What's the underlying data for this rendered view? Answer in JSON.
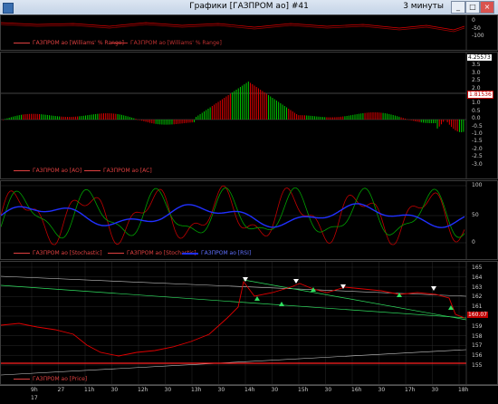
{
  "window": {
    "title": "Графики [ГАЗПРОМ ао] #41",
    "interval": "3 минуты",
    "buttons": [
      "_",
      "□",
      "×"
    ]
  },
  "panes": {
    "wpr": {
      "legend": [
        "ГАЗПРОМ ао [Williams' % Range]",
        "ГАЗПРОМ ао [Williams' % Range]"
      ],
      "ticks": [
        "0",
        "-50",
        "-100"
      ]
    },
    "ao": {
      "legend": [
        "ГАЗПРОМ ао [AO]",
        "ГАЗПРОМ ао [AC]"
      ],
      "ticks": [
        "4.0",
        "3.5",
        "3.0",
        "2.5",
        "2.0",
        "1.5",
        "1.0",
        "0.5",
        "0.0",
        "-0.5",
        "-1.0",
        "-1.5",
        "-2.0",
        "-2.5",
        "-3.0"
      ],
      "tag_top": "4.25573",
      "tag_mid": "1.81536"
    },
    "osc": {
      "legend": [
        "ГАЗПРОМ ао [Stochastic]",
        "ГАЗПРОМ ао [Stochastic]",
        "ГАЗПРОМ ао [RSI]"
      ],
      "ticks": [
        "100",
        "50",
        "0"
      ]
    },
    "price": {
      "legend": [
        "ГАЗПРОМ ао [Price]"
      ],
      "ticks": [
        "165",
        "164",
        "163",
        "162",
        "161",
        "160",
        "159",
        "158",
        "157",
        "156",
        "155"
      ],
      "tag_last": "160.07"
    }
  },
  "time_axis": {
    "labels": [
      "9h",
      "27",
      "11h",
      "30",
      "12h",
      "30",
      "13h",
      "30",
      "14h",
      "30",
      "15h",
      "30",
      "16h",
      "30",
      "17h",
      "30",
      "18h"
    ],
    "sublabel": "17"
  },
  "colors": {
    "up": "#00c800",
    "down": "#e00000",
    "rsi": "#2030ff",
    "channel": "#30e060",
    "pane_border": "#3c3c3c"
  }
}
